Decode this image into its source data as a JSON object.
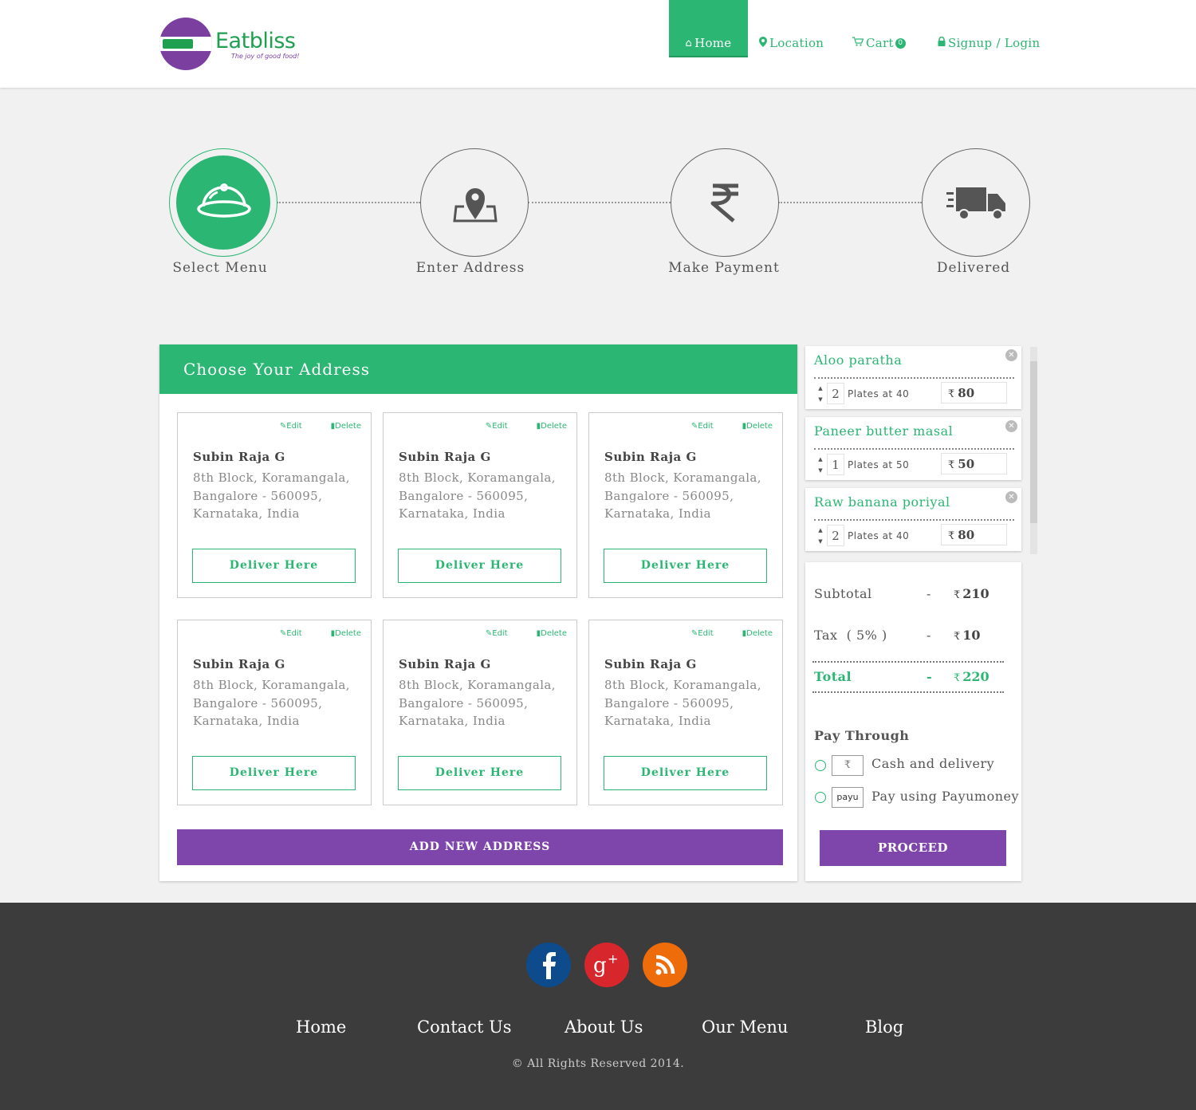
{
  "brand": {
    "name": "Eatbliss",
    "tagline": "The joy of good food!",
    "colors": {
      "primary": "#2bb673",
      "accent": "#7e46aa",
      "footer": "#3c3c3c"
    }
  },
  "nav": {
    "home": "Home",
    "location": "Location",
    "cart": "Cart",
    "cart_count": "0",
    "login": "Signup / Login"
  },
  "steps": [
    {
      "label": "Select Menu",
      "icon": "food-cloche-icon",
      "active": true
    },
    {
      "label": "Enter Address",
      "icon": "map-pin-icon",
      "active": false
    },
    {
      "label": "Make Payment",
      "icon": "rupee-icon",
      "active": false
    },
    {
      "label": "Delivered",
      "icon": "delivery-truck-icon",
      "active": false
    }
  ],
  "address_panel": {
    "title": "Choose Your Address",
    "edit_label": "Edit",
    "delete_label": "Delete",
    "deliver_label": "Deliver Here",
    "add_label": "ADD NEW ADDRESS",
    "cards": [
      {
        "name": "Subin Raja G",
        "line1": "8th Block, Koramangala,",
        "line2": "Bangalore - 560095,",
        "line3": "Karnataka, India"
      },
      {
        "name": "Subin Raja G",
        "line1": "8th Block, Koramangala,",
        "line2": "Bangalore - 560095,",
        "line3": "Karnataka, India"
      },
      {
        "name": "Subin Raja G",
        "line1": "8th Block, Koramangala,",
        "line2": "Bangalore - 560095,",
        "line3": "Karnataka, India"
      },
      {
        "name": "Subin Raja G",
        "line1": "8th Block, Koramangala,",
        "line2": "Bangalore - 560095,",
        "line3": "Karnataka, India"
      },
      {
        "name": "Subin Raja G",
        "line1": "8th Block, Koramangala,",
        "line2": "Bangalore - 560095,",
        "line3": "Karnataka, India"
      },
      {
        "name": "Subin Raja G",
        "line1": "8th Block, Koramangala,",
        "line2": "Bangalore - 560095,",
        "line3": "Karnataka, India"
      }
    ]
  },
  "cart_items": [
    {
      "name": "Aloo paratha",
      "qty": "2",
      "plates": "Plates at 40",
      "price": "80"
    },
    {
      "name": "Paneer butter masal",
      "qty": "1",
      "plates": "Plates at 50",
      "price": "50"
    },
    {
      "name": "Raw banana poriyal",
      "qty": "2",
      "plates": "Plates at 40",
      "price": "80"
    }
  ],
  "summary": {
    "currency": "₹",
    "subtotal_label": "Subtotal",
    "subtotal": "210",
    "tax_label": "Tax  ( 5% )",
    "tax": "10",
    "total_label": "Total",
    "total": "220",
    "dash": "-",
    "pay_title": "Pay Through",
    "option_cash": "Cash and delivery",
    "option_payu": "Pay using Payumoney",
    "payu_logo": "payu",
    "proceed": "PROCEED"
  },
  "footer": {
    "links": [
      "Home",
      "Contact Us",
      "About Us",
      "Our Menu",
      "Blog"
    ],
    "social": [
      "facebook-icon",
      "google-plus-icon",
      "rss-icon"
    ],
    "copyright": "© All Rights Reserved 2014."
  }
}
